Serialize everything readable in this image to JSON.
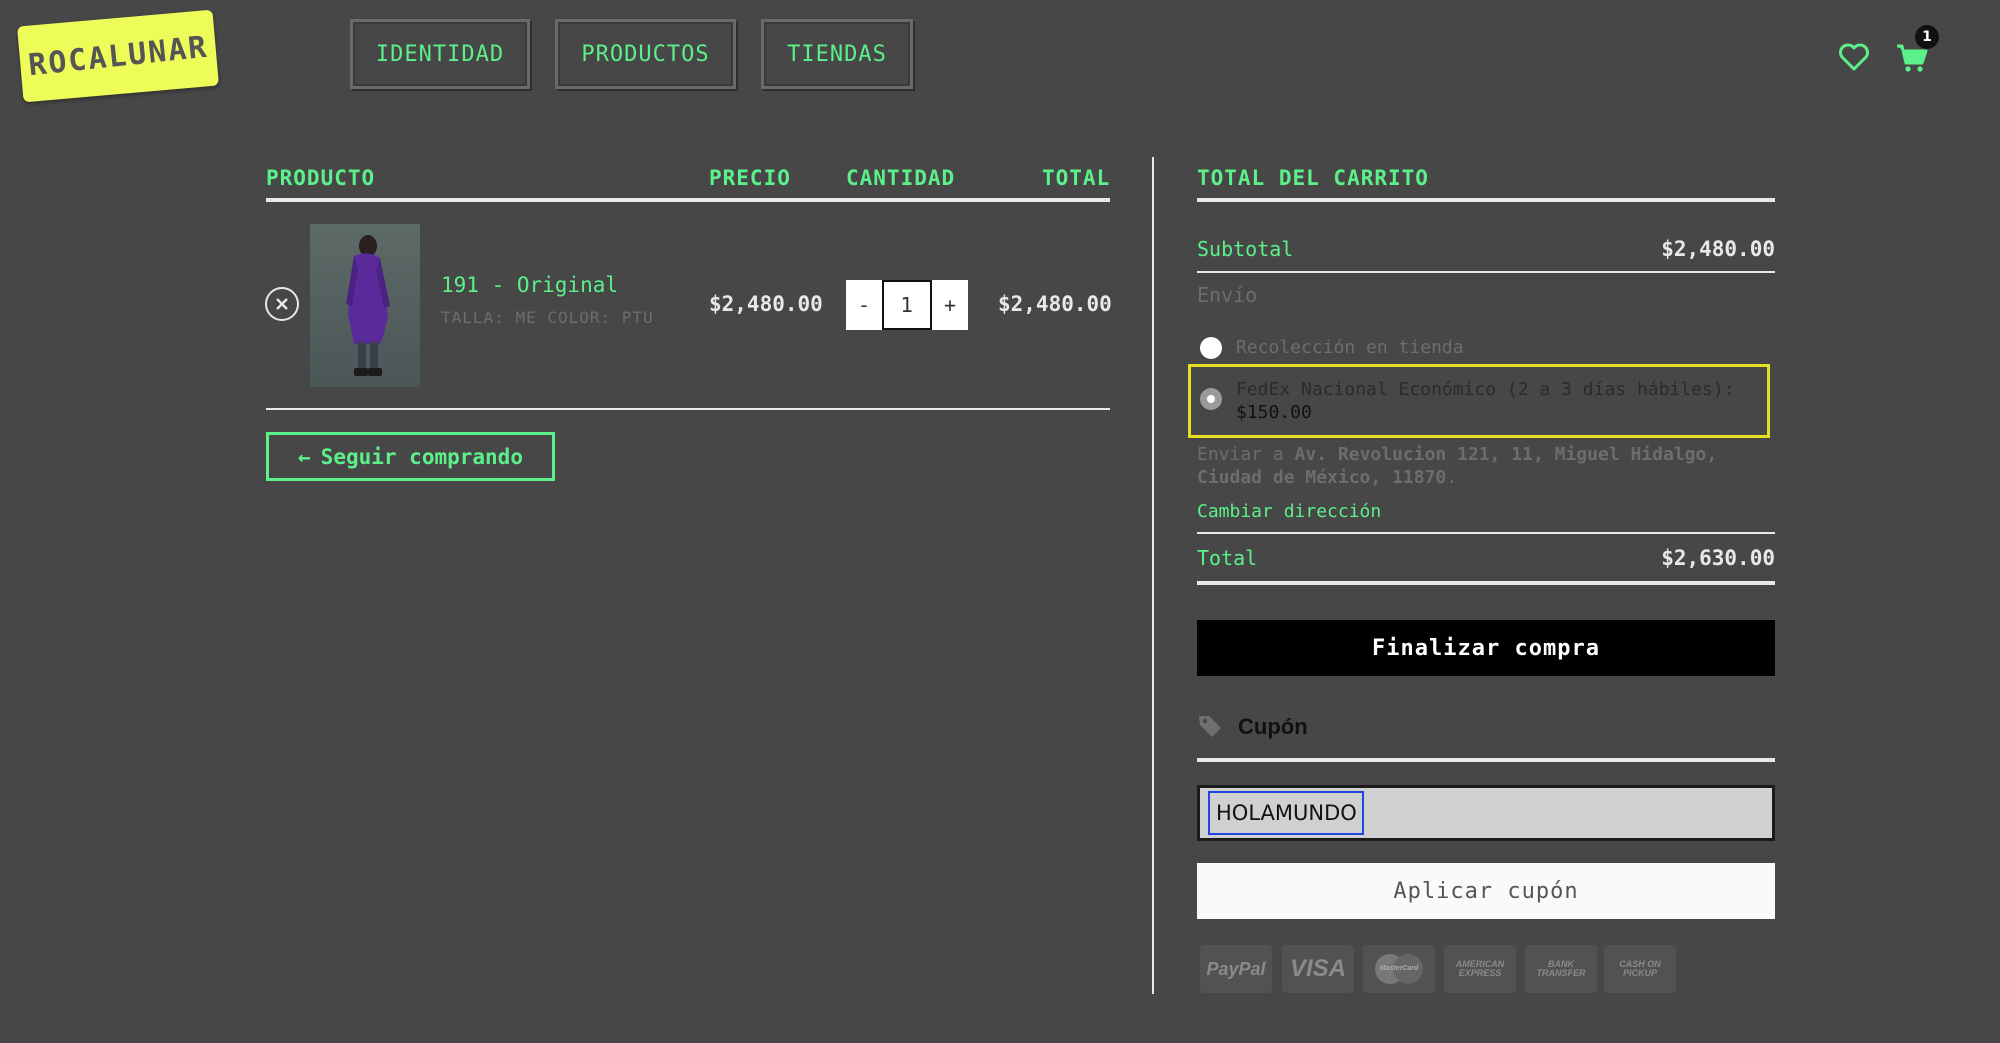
{
  "brand": {
    "logo_text": "ROCALUNAR"
  },
  "nav": {
    "items": [
      {
        "label": "IDENTIDAD"
      },
      {
        "label": "PRODUCTOS"
      },
      {
        "label": "TIENDAS"
      }
    ]
  },
  "header": {
    "cart_count": "1"
  },
  "cart": {
    "headers": {
      "producto": "PRODUCTO",
      "precio": "PRECIO",
      "cantidad": "CANTIDAD",
      "total": "TOTAL"
    },
    "item": {
      "name": "191 - Original",
      "talla_label": "TALLA:",
      "talla_value": "ME",
      "color_label": "COLOR:",
      "color_value": "PTU",
      "price": "$2,480.00",
      "quantity": "1",
      "minus": "-",
      "plus": "+",
      "total": "$2,480.00"
    },
    "continue_label": "Seguir comprando",
    "continue_arrow": "←"
  },
  "totals": {
    "title": "TOTAL DEL CARRITO",
    "subtotal_label": "Subtotal",
    "subtotal_value": "$2,480.00",
    "envio_label": "Envío",
    "shipping_options": [
      {
        "label": "Recolección en tienda",
        "selected": false
      },
      {
        "label": "FedEx Nacional Económico (2 a 3 días hábiles):",
        "price": "$150.00",
        "selected": true
      }
    ],
    "ship_to_prefix": "Enviar a",
    "ship_to_line1": "Av. Revolucion 121, 11, Miguel Hidalgo,",
    "ship_to_line2": "Ciudad de México, 11870",
    "ship_to_suffix": ".",
    "change_address": "Cambiar dirección",
    "total_label": "Total",
    "total_value": "$2,630.00",
    "checkout_label": "Finalizar compra"
  },
  "coupon": {
    "title": "Cupón",
    "value": "HOLAMUNDO",
    "apply_label": "Aplicar cupón"
  },
  "payments": {
    "paypal": "PayPal",
    "visa": "VISA",
    "mastercard": "MasterCard",
    "amex_line1": "AMERICAN",
    "amex_line2": "EXPRESS",
    "bank_line1": "BANK",
    "bank_line2": "TRANSFER",
    "cash_line1": "CASH ON",
    "cash_line2": "PICKUP"
  },
  "colors": {
    "accent": "#5cf08a",
    "background": "#474747",
    "highlight": "#e6e022",
    "focus": "#1f47e0"
  }
}
